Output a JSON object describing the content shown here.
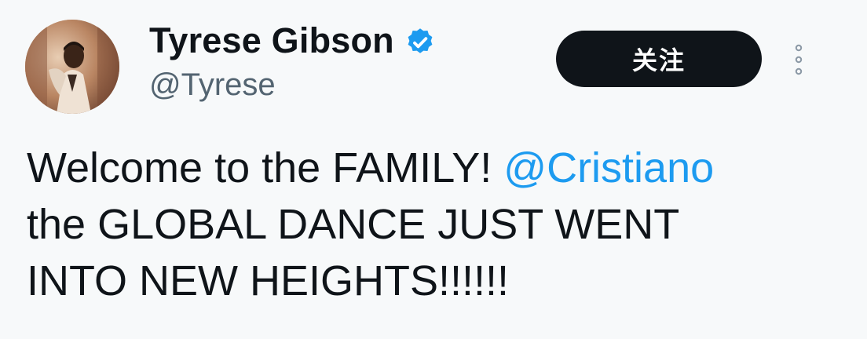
{
  "author": {
    "display_name": "Tyrese Gibson",
    "handle": "@Tyrese",
    "verified": true,
    "avatar_icon": "profile-photo"
  },
  "actions": {
    "follow_label": "关注",
    "more_icon": "more-vertical-icon"
  },
  "tweet": {
    "line1_text": "Welcome to the FAMILY!",
    "line1_mention": "@Cristiano",
    "line2_text": "the GLOBAL DANCE JUST WENT",
    "line3_text": "INTO NEW HEIGHTS!!!!!!"
  },
  "colors": {
    "background": "#f7f9fa",
    "text": "#0f1419",
    "secondary_text": "#536471",
    "accent": "#1d9bf0",
    "button": "#0f1419"
  }
}
